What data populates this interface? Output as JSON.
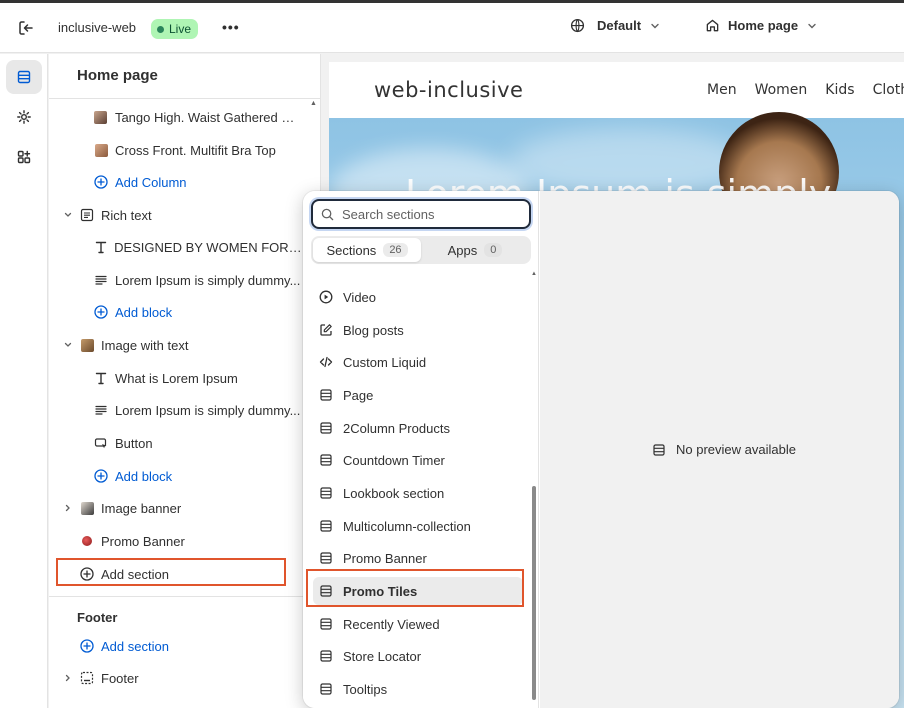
{
  "topbar": {
    "store_name": "inclusive-web",
    "status_badge": "Live",
    "more": "•••",
    "theme_selector": "Default",
    "page_selector": "Home page"
  },
  "sidebar": {
    "title": "Home page",
    "items": [
      {
        "label": "Tango High. Waist Gathered Si...",
        "kind": "product",
        "thumb": "#8a6a5a"
      },
      {
        "label": "Cross Front. Multifit Bra Top",
        "kind": "product",
        "thumb": "#b07a5a"
      },
      {
        "label": "Add Column",
        "kind": "add"
      },
      {
        "label": "Rich text",
        "kind": "section"
      },
      {
        "label": "DESIGNED BY WOMEN FOR W...",
        "kind": "heading-block"
      },
      {
        "label": "Lorem Ipsum is simply dummy...",
        "kind": "text-block"
      },
      {
        "label": "Add block",
        "kind": "add"
      },
      {
        "label": "Image with text",
        "kind": "section"
      },
      {
        "label": "What is Lorem Ipsum",
        "kind": "heading-block"
      },
      {
        "label": "Lorem Ipsum is simply dummy...",
        "kind": "text-block"
      },
      {
        "label": "Button",
        "kind": "button-block"
      },
      {
        "label": "Add block",
        "kind": "add"
      },
      {
        "label": "Image banner",
        "kind": "section"
      },
      {
        "label": "Promo Banner",
        "kind": "section"
      },
      {
        "label": "Add section",
        "kind": "add-section"
      }
    ],
    "footer": {
      "heading": "Footer",
      "add_section": "Add section",
      "footer_item": "Footer"
    }
  },
  "preview": {
    "logo": "web-inclusive",
    "nav": [
      "Men",
      "Women",
      "Kids",
      "Cloth"
    ],
    "hero_text": "Lorem Ipsum is simply"
  },
  "picker": {
    "search_placeholder": "Search sections",
    "tabs": [
      {
        "label": "Sections",
        "count": "26"
      },
      {
        "label": "Apps",
        "count": "0"
      }
    ],
    "items": [
      "Video",
      "Blog posts",
      "Custom Liquid",
      "Page",
      "2Column Products",
      "Countdown Timer",
      "Lookbook section",
      "Multicolumn-collection",
      "Promo Banner",
      "Promo Tiles",
      "Recently Viewed",
      "Store Locator",
      "Tooltips"
    ],
    "selected_item": "Promo Tiles",
    "no_preview": "No preview available"
  },
  "colors": {
    "accent_blue": "#005bd3",
    "highlight_orange": "#e0552c",
    "live_badge_bg": "#aff5b4"
  }
}
